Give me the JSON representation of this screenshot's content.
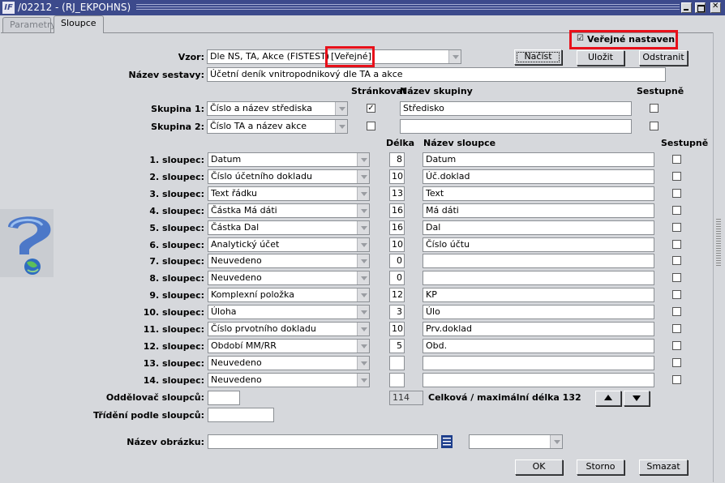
{
  "window": {
    "icon_text": "IF",
    "title": "/02212 - (RJ_EKPOHNS)"
  },
  "tabs": [
    {
      "label": "Parametry"
    },
    {
      "label": "Sloupce"
    }
  ],
  "public_setting": {
    "label": "Veřejné nastavení",
    "checked": true
  },
  "template": {
    "label": "Vzor:",
    "value": "Dle NS, TA, Akce   (FISTEST)",
    "public_tag": "[Veřejné]"
  },
  "buttons": {
    "load": "Načíst",
    "save": "Uložit",
    "remove": "Odstranit",
    "ok": "OK",
    "cancel": "Storno",
    "delete": "Smazat"
  },
  "report_name": {
    "label": "Název sestavy:",
    "value": "Účetní deník vnitropodnikový dle TA a akce"
  },
  "group_headers": {
    "paging": "Stránkovat",
    "group_name": "Název skupiny",
    "desc": "Sestupně"
  },
  "groups": [
    {
      "label": "Skupina 1:",
      "value": "Číslo a název střediska",
      "paging": true,
      "name": "Středisko",
      "desc": false
    },
    {
      "label": "Skupina 2:",
      "value": "Číslo TA a název akce",
      "paging": false,
      "name": "",
      "desc": false
    }
  ],
  "column_headers": {
    "length": "Délka",
    "column_name": "Název sloupce",
    "desc": "Sestupně"
  },
  "columns": [
    {
      "label": "1. sloupec:",
      "value": "Datum",
      "length": "8",
      "name": "Datum",
      "desc": false
    },
    {
      "label": "2. sloupec:",
      "value": "Číslo účetního dokladu",
      "length": "10",
      "name": "Úč.doklad",
      "desc": false
    },
    {
      "label": "3. sloupec:",
      "value": "Text řádku",
      "length": "13",
      "name": "Text",
      "desc": false
    },
    {
      "label": "4. sloupec:",
      "value": "Částka Má dáti",
      "length": "16",
      "name": "Má dáti",
      "desc": false
    },
    {
      "label": "5. sloupec:",
      "value": "Částka Dal",
      "length": "16",
      "name": "Dal",
      "desc": false
    },
    {
      "label": "6. sloupec:",
      "value": "Analytický účet",
      "length": "10",
      "name": "Číslo účtu",
      "desc": false
    },
    {
      "label": "7. sloupec:",
      "value": "Neuvedeno",
      "length": "0",
      "name": "",
      "desc": false
    },
    {
      "label": "8. sloupec:",
      "value": "Neuvedeno",
      "length": "0",
      "name": "",
      "desc": false
    },
    {
      "label": "9. sloupec:",
      "value": "Komplexní položka",
      "length": "12",
      "name": "KP",
      "desc": false
    },
    {
      "label": "10. sloupec:",
      "value": "Úloha",
      "length": "3",
      "name": "Úlo",
      "desc": false
    },
    {
      "label": "11. sloupec:",
      "value": "Číslo prvotního dokladu",
      "length": "10",
      "name": "Prv.doklad",
      "desc": false
    },
    {
      "label": "12. sloupec:",
      "value": "Období MM/RR",
      "length": "5",
      "name": "Obd.",
      "desc": false
    },
    {
      "label": "13. sloupec:",
      "value": "Neuvedeno",
      "length": "",
      "name": "",
      "desc": false
    },
    {
      "label": "14. sloupec:",
      "value": "Neuvedeno",
      "length": "",
      "name": "",
      "desc": false
    }
  ],
  "separator": {
    "label": "Oddělovač sloupců:",
    "value": ""
  },
  "total_length": {
    "value": "114",
    "label": "Celková / maximální délka 132"
  },
  "sorting": {
    "label": "Třídění podle sloupců:",
    "value": ""
  },
  "image_name": {
    "label": "Název obrázku:",
    "value": "",
    "select_value": ""
  }
}
